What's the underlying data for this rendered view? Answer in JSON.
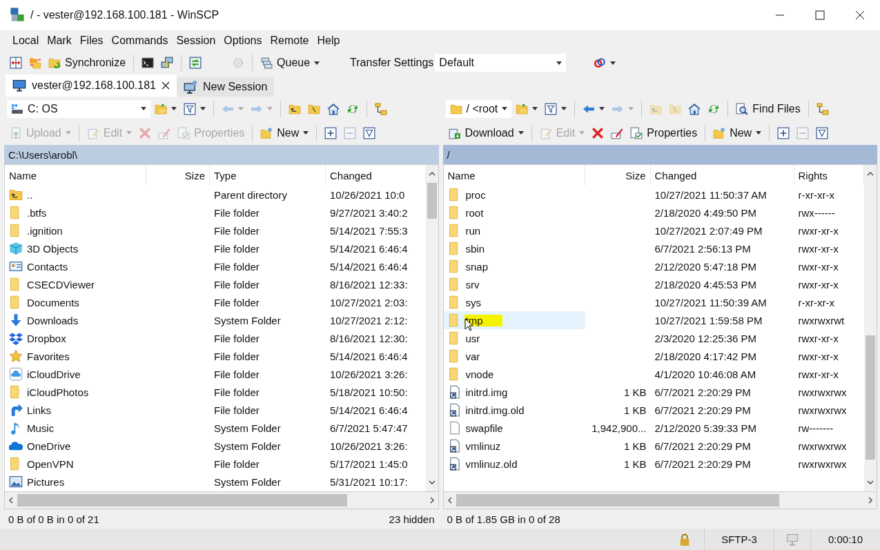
{
  "window": {
    "title": "/ - vester@192.168.100.181 - WinSCP"
  },
  "menu": [
    "Local",
    "Mark",
    "Files",
    "Commands",
    "Session",
    "Options",
    "Remote",
    "Help"
  ],
  "toolbar": [
    {
      "kind": "compare",
      "disabled": false
    },
    {
      "kind": "sync",
      "disabled": false
    },
    {
      "kind": "synchronize",
      "label": "Synchronize",
      "disabled": false
    },
    {
      "kind": "sep"
    },
    {
      "kind": "console",
      "disabled": false
    },
    {
      "kind": "putty",
      "disabled": false
    },
    {
      "kind": "sep"
    },
    {
      "kind": "session",
      "disabled": false
    },
    {
      "kind": "gap"
    },
    {
      "kind": "preferences",
      "disabled": true
    },
    {
      "kind": "sep"
    },
    {
      "kind": "queue",
      "label": "Queue",
      "dropdown": true,
      "disabled": false
    },
    {
      "kind": "gap"
    },
    {
      "kind": "text",
      "label": "Transfer Settings"
    },
    {
      "kind": "combo",
      "value": "Default"
    },
    {
      "kind": "gap"
    },
    {
      "kind": "connection",
      "dropdown": true,
      "disabled": false
    }
  ],
  "tabs": [
    {
      "label": "vester@192.168.100.181",
      "selected": true,
      "closable": true
    },
    {
      "label": "New Session",
      "selected": false,
      "closable": false
    }
  ],
  "panels": [
    {
      "active": false,
      "path": "C:\\Users\\arobl\\",
      "toolbar1": [
        {
          "kind": "drive",
          "value": "C: OS"
        },
        {
          "kind": "open",
          "dropdown": true,
          "disabled": false
        },
        {
          "kind": "filter",
          "dropdown": true,
          "disabled": false
        },
        {
          "kind": "sep"
        },
        {
          "kind": "back",
          "dropdown": true,
          "disabled": true
        },
        {
          "kind": "forward",
          "dropdown": true,
          "disabled": true
        },
        {
          "kind": "sep"
        },
        {
          "kind": "parent",
          "disabled": false
        },
        {
          "kind": "root",
          "disabled": false
        },
        {
          "kind": "home",
          "disabled": false
        },
        {
          "kind": "refresh",
          "disabled": false
        },
        {
          "kind": "sep"
        },
        {
          "kind": "tree",
          "disabled": false
        }
      ],
      "toolbar2": [
        {
          "kind": "upload",
          "label": "Upload",
          "dropdown": true,
          "disabled": true
        },
        {
          "kind": "sep"
        },
        {
          "kind": "edit",
          "label": "Edit",
          "dropdown": true,
          "disabled": true
        },
        {
          "kind": "delete",
          "disabled": true
        },
        {
          "kind": "rename",
          "disabled": true
        },
        {
          "kind": "properties",
          "label": "Properties",
          "disabled": true
        },
        {
          "kind": "sep"
        },
        {
          "kind": "new",
          "label": "New",
          "dropdown": true,
          "disabled": false
        },
        {
          "kind": "sep"
        },
        {
          "kind": "select",
          "disabled": false
        },
        {
          "kind": "unselect",
          "disabled": true
        },
        {
          "kind": "filtersel",
          "disabled": false
        }
      ],
      "columns": [
        "Name",
        "Size",
        "Type",
        "Changed"
      ],
      "rows": [
        {
          "kind": "parent",
          "name": "..",
          "type": "Parent directory",
          "changed": "10/26/2021 10:0",
          "selected": false
        },
        {
          "kind": "folder",
          "name": ".btfs",
          "type": "File folder",
          "changed": "9/27/2021 3:40:2",
          "selected": false
        },
        {
          "kind": "folder",
          "name": ".ignition",
          "type": "File folder",
          "changed": "5/14/2021 7:55:3",
          "selected": false
        },
        {
          "kind": "cube",
          "name": "3D Objects",
          "type": "File folder",
          "changed": "5/14/2021 6:46:4",
          "selected": false
        },
        {
          "kind": "contacts",
          "name": "Contacts",
          "type": "File folder",
          "changed": "5/14/2021 6:46:4",
          "selected": false
        },
        {
          "kind": "folder",
          "name": "CSECDViewer",
          "type": "File folder",
          "changed": "8/16/2021 12:33:",
          "selected": false
        },
        {
          "kind": "folder",
          "name": "Documents",
          "type": "File folder",
          "changed": "10/27/2021 2:03:",
          "selected": false
        },
        {
          "kind": "downloads",
          "name": "Downloads",
          "type": "System Folder",
          "changed": "10/27/2021 2:12:",
          "selected": false
        },
        {
          "kind": "boxes",
          "name": "Dropbox",
          "type": "File folder",
          "changed": "8/16/2021 12:30:",
          "selected": false
        },
        {
          "kind": "star",
          "name": "Favorites",
          "type": "File folder",
          "changed": "5/14/2021 6:46:4",
          "selected": false
        },
        {
          "kind": "cloudline",
          "name": "iCloudDrive",
          "type": "File folder",
          "changed": "10/26/2021 3:26:",
          "selected": false
        },
        {
          "kind": "folder",
          "name": "iCloudPhotos",
          "type": "File folder",
          "changed": "5/18/2021 10:50:",
          "selected": false
        },
        {
          "kind": "links",
          "name": "Links",
          "type": "File folder",
          "changed": "5/14/2021 6:46:4",
          "selected": false
        },
        {
          "kind": "music",
          "name": "Music",
          "type": "System Folder",
          "changed": "6/7/2021 5:47:47",
          "selected": false
        },
        {
          "kind": "cloud",
          "name": "OneDrive",
          "type": "System Folder",
          "changed": "10/26/2021 3:26:",
          "selected": false
        },
        {
          "kind": "folder",
          "name": "OpenVPN",
          "type": "File folder",
          "changed": "5/17/2021 1:45:0",
          "selected": false
        },
        {
          "kind": "pictures",
          "name": "Pictures",
          "type": "System Folder",
          "changed": "5/31/2021 10:17:",
          "selected": false
        }
      ],
      "status": "0 B of 0 B in 0 of 21",
      "hidden": "23 hidden"
    },
    {
      "active": true,
      "path": "/",
      "toolbar1": [
        {
          "kind": "dir",
          "value": "/ <root"
        },
        {
          "kind": "open",
          "dropdown": true,
          "disabled": false
        },
        {
          "kind": "filter",
          "dropdown": true,
          "disabled": false
        },
        {
          "kind": "sep"
        },
        {
          "kind": "back",
          "dropdown": true,
          "disabled": false
        },
        {
          "kind": "forward",
          "dropdown": true,
          "disabled": true
        },
        {
          "kind": "sep"
        },
        {
          "kind": "parent",
          "disabled": true
        },
        {
          "kind": "root",
          "disabled": true
        },
        {
          "kind": "home",
          "disabled": false
        },
        {
          "kind": "refresh",
          "disabled": false
        },
        {
          "kind": "sep"
        },
        {
          "kind": "find",
          "label": "Find Files",
          "disabled": false
        },
        {
          "kind": "sep"
        },
        {
          "kind": "tree",
          "disabled": false
        }
      ],
      "toolbar2": [
        {
          "kind": "download",
          "label": "Download",
          "dropdown": true,
          "disabled": false
        },
        {
          "kind": "sep"
        },
        {
          "kind": "edit",
          "label": "Edit",
          "dropdown": true,
          "disabled": true
        },
        {
          "kind": "delete",
          "disabled": false
        },
        {
          "kind": "rename",
          "disabled": false
        },
        {
          "kind": "properties",
          "label": "Properties",
          "disabled": false
        },
        {
          "kind": "sep"
        },
        {
          "kind": "new",
          "label": "New",
          "dropdown": true,
          "disabled": false
        },
        {
          "kind": "sep"
        },
        {
          "kind": "select",
          "disabled": false
        },
        {
          "kind": "unselect",
          "disabled": true
        },
        {
          "kind": "filtersel",
          "disabled": false
        }
      ],
      "columns": [
        "Name",
        "Size",
        "Changed",
        "Rights"
      ],
      "rows": [
        {
          "kind": "folder",
          "name": "proc",
          "changed": "10/27/2021 11:50:37 AM",
          "rights": "r-xr-xr-x",
          "selected": false,
          "highlighted": false,
          "pointer": false
        },
        {
          "kind": "folder",
          "name": "root",
          "changed": "2/18/2020 4:49:50 PM",
          "rights": "rwx------",
          "selected": false,
          "highlighted": false,
          "pointer": false
        },
        {
          "kind": "folder",
          "name": "run",
          "changed": "10/27/2021 2:07:49 PM",
          "rights": "rwxr-xr-x",
          "selected": false,
          "highlighted": false,
          "pointer": false
        },
        {
          "kind": "folder",
          "name": "sbin",
          "changed": "6/7/2021 2:56:13 PM",
          "rights": "rwxr-xr-x",
          "selected": false,
          "highlighted": false,
          "pointer": false
        },
        {
          "kind": "folder",
          "name": "snap",
          "changed": "2/12/2020 5:47:18 PM",
          "rights": "rwxr-xr-x",
          "selected": false,
          "highlighted": false,
          "pointer": false
        },
        {
          "kind": "folder",
          "name": "srv",
          "changed": "2/18/2020 4:45:53 PM",
          "rights": "rwxr-xr-x",
          "selected": false,
          "highlighted": false,
          "pointer": false
        },
        {
          "kind": "folder",
          "name": "sys",
          "changed": "10/27/2021 11:50:39 AM",
          "rights": "r-xr-xr-x",
          "selected": false,
          "highlighted": false,
          "pointer": false
        },
        {
          "kind": "folder",
          "name": "tmp",
          "changed": "10/27/2021 1:59:58 PM",
          "rights": "rwxrwxrwt",
          "selected": true,
          "highlighted": true,
          "pointer": true
        },
        {
          "kind": "folder",
          "name": "usr",
          "changed": "2/3/2020 12:25:36 PM",
          "rights": "rwxr-xr-x",
          "selected": false,
          "highlighted": false,
          "pointer": false
        },
        {
          "kind": "folder",
          "name": "var",
          "changed": "2/18/2020 4:17:42 PM",
          "rights": "rwxr-xr-x",
          "selected": false,
          "highlighted": false,
          "pointer": false
        },
        {
          "kind": "folder",
          "name": "vnode",
          "changed": "4/1/2020 10:46:08 AM",
          "rights": "rwxr-xr-x",
          "selected": false,
          "highlighted": false,
          "pointer": false
        },
        {
          "kind": "shortcut",
          "name": "initrd.img",
          "size": "1 KB",
          "changed": "6/7/2021 2:20:29 PM",
          "rights": "rwxrwxrwx",
          "selected": false,
          "highlighted": false,
          "pointer": false
        },
        {
          "kind": "shortcut",
          "name": "initrd.img.old",
          "size": "1 KB",
          "changed": "6/7/2021 2:20:29 PM",
          "rights": "rwxrwxrwx",
          "selected": false,
          "highlighted": false,
          "pointer": false
        },
        {
          "kind": "file",
          "name": "swapfile",
          "size": "1,942,900...",
          "changed": "2/12/2020 5:39:33 PM",
          "rights": "rw-------",
          "selected": false,
          "highlighted": false,
          "pointer": false
        },
        {
          "kind": "shortcut",
          "name": "vmlinuz",
          "size": "1 KB",
          "changed": "6/7/2021 2:20:29 PM",
          "rights": "rwxrwxrwx",
          "selected": false,
          "highlighted": false,
          "pointer": false
        },
        {
          "kind": "shortcut",
          "name": "vmlinuz.old",
          "size": "1 KB",
          "changed": "6/7/2021 2:20:29 PM",
          "rights": "rwxrwxrwx",
          "selected": false,
          "highlighted": false,
          "pointer": false
        }
      ],
      "status": "0 B of 1.85 GB in 0 of 28"
    }
  ],
  "status_bar": {
    "protocol": "SFTP-3",
    "time": "0:00:10"
  }
}
